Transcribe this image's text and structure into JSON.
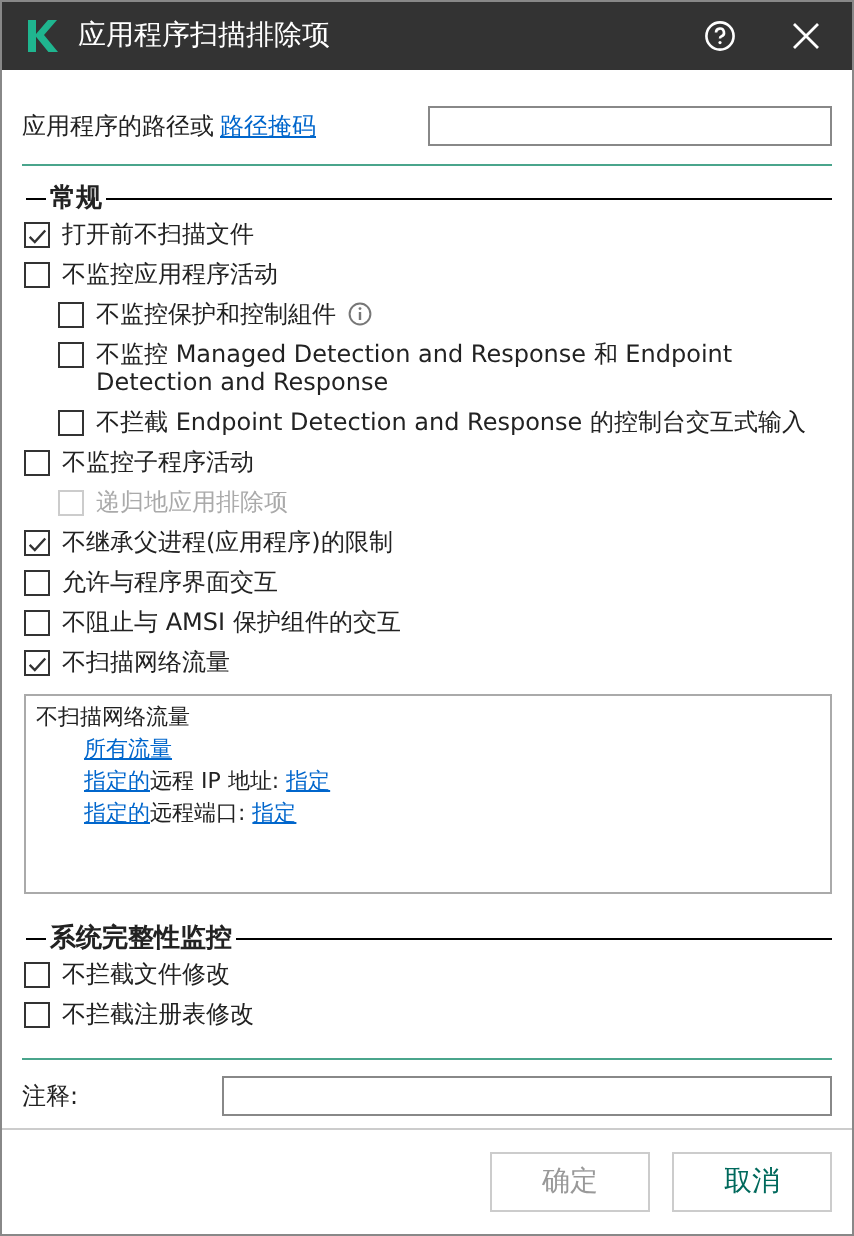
{
  "window": {
    "title": "应用程序扫描排除项"
  },
  "path_field": {
    "label": "应用程序的路径或",
    "link": "路径掩码"
  },
  "sections": [
    {
      "title": "常规",
      "options": [
        {
          "label": "打开前不扫描文件",
          "checked": true,
          "disabled": false
        },
        {
          "label": "不监控应用程序活动",
          "checked": false,
          "disabled": false,
          "children": [
            {
              "label": "不监控保护和控制組件",
              "checked": false,
              "disabled": false,
              "info": true
            },
            {
              "label": "不监控 Managed Detection and Response 和 Endpoint Detection and Response",
              "checked": false,
              "disabled": false
            },
            {
              "label": "不拦截 Endpoint Detection and Response 的控制台交互式输入",
              "checked": false,
              "disabled": false
            }
          ]
        },
        {
          "label": "不监控子程序活动",
          "checked": false,
          "disabled": false,
          "children": [
            {
              "label": "递归地应用排除项",
              "checked": false,
              "disabled": true
            }
          ]
        },
        {
          "label": "不继承父进程(应用程序)的限制",
          "checked": true,
          "disabled": false
        },
        {
          "label": "允许与程序界面交互",
          "checked": false,
          "disabled": false
        },
        {
          "label": "不阻止与 AMSI 保护组件的交互",
          "checked": false,
          "disabled": false
        },
        {
          "label": "不扫描网络流量",
          "checked": true,
          "disabled": false
        }
      ],
      "traffic_box": {
        "title": "不扫描网络流量",
        "lines": [
          [
            {
              "text": "所有流量",
              "link": true
            }
          ],
          [
            {
              "text": "指定的",
              "link": true
            },
            {
              "text": "远程 IP 地址: ",
              "link": false
            },
            {
              "text": "指定",
              "link": true
            }
          ],
          [
            {
              "text": "指定的",
              "link": true
            },
            {
              "text": "远程端口: ",
              "link": false
            },
            {
              "text": "指定",
              "link": true
            }
          ]
        ]
      }
    },
    {
      "title": "系统完整性监控",
      "options": [
        {
          "label": "不拦截文件修改",
          "checked": false,
          "disabled": false
        },
        {
          "label": "不拦截注册表修改",
          "checked": false,
          "disabled": false
        }
      ]
    }
  ],
  "comment_field": {
    "label": "注释:"
  },
  "buttons": [
    {
      "label": "确定",
      "disabled": true
    },
    {
      "label": "取消",
      "disabled": false
    }
  ]
}
